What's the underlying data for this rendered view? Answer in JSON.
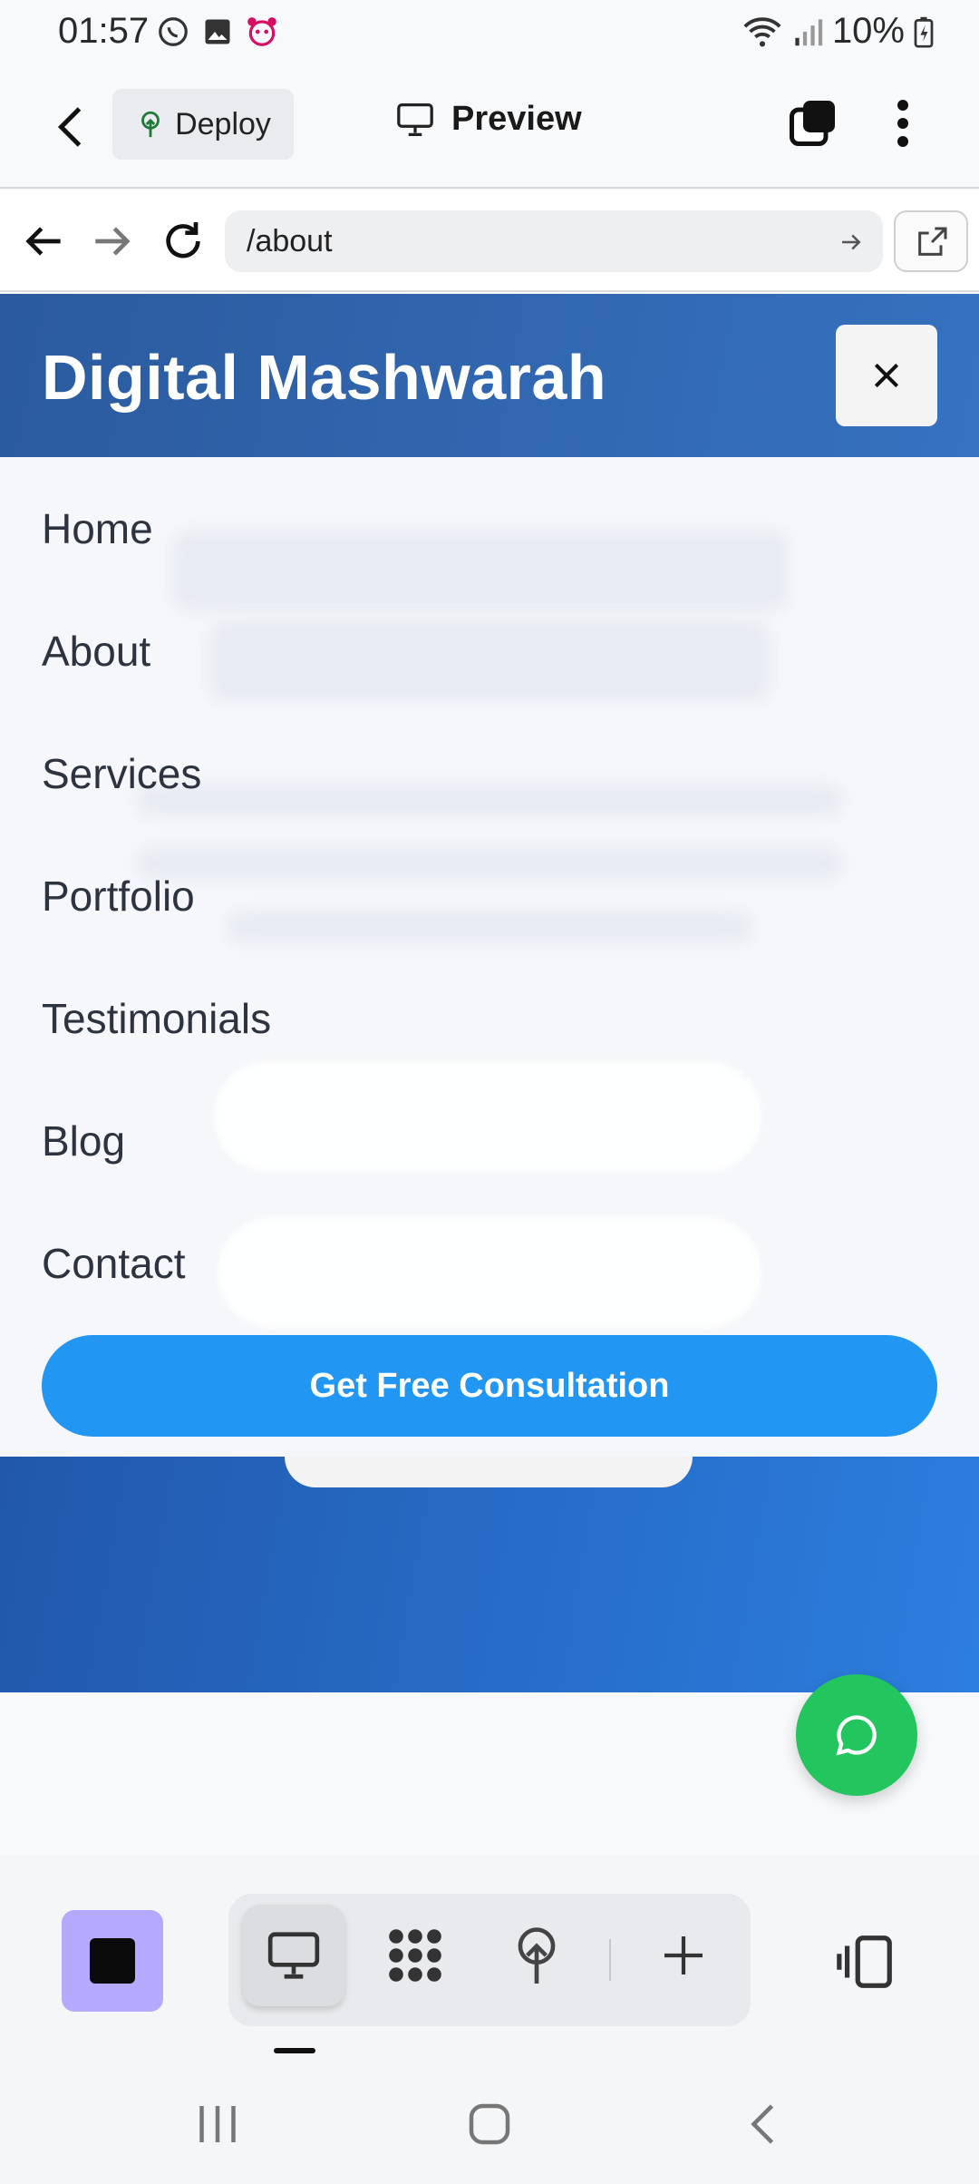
{
  "status_bar": {
    "time": "01:57",
    "battery": "10%",
    "left_icons": [
      "whatsapp-icon",
      "gallery-icon",
      "foodpanda-icon"
    ],
    "right_icons": [
      "wifi-icon",
      "signal-icon",
      "battery-charging-icon"
    ]
  },
  "app_header": {
    "deploy_label": "Deploy",
    "preview_label": "Preview"
  },
  "browser": {
    "url": "/about"
  },
  "site": {
    "brand": "Digital Mashwarah",
    "menu": [
      "Home",
      "About",
      "Services",
      "Portfolio",
      "Testimonials",
      "Blog",
      "Contact"
    ],
    "cta_label": "Get Free Consultation"
  },
  "toolbar": {
    "tools": [
      "desktop-preview-icon",
      "dots-grid-icon",
      "deploy-tree-icon",
      "add-icon"
    ],
    "active_tool": "desktop-preview-icon"
  },
  "colors": {
    "header_gradient_start": "#2b5a9e",
    "header_gradient_end": "#3672c0",
    "cta": "#2196f3",
    "chat": "#22c55e",
    "avatar": "#b5a8ff"
  }
}
